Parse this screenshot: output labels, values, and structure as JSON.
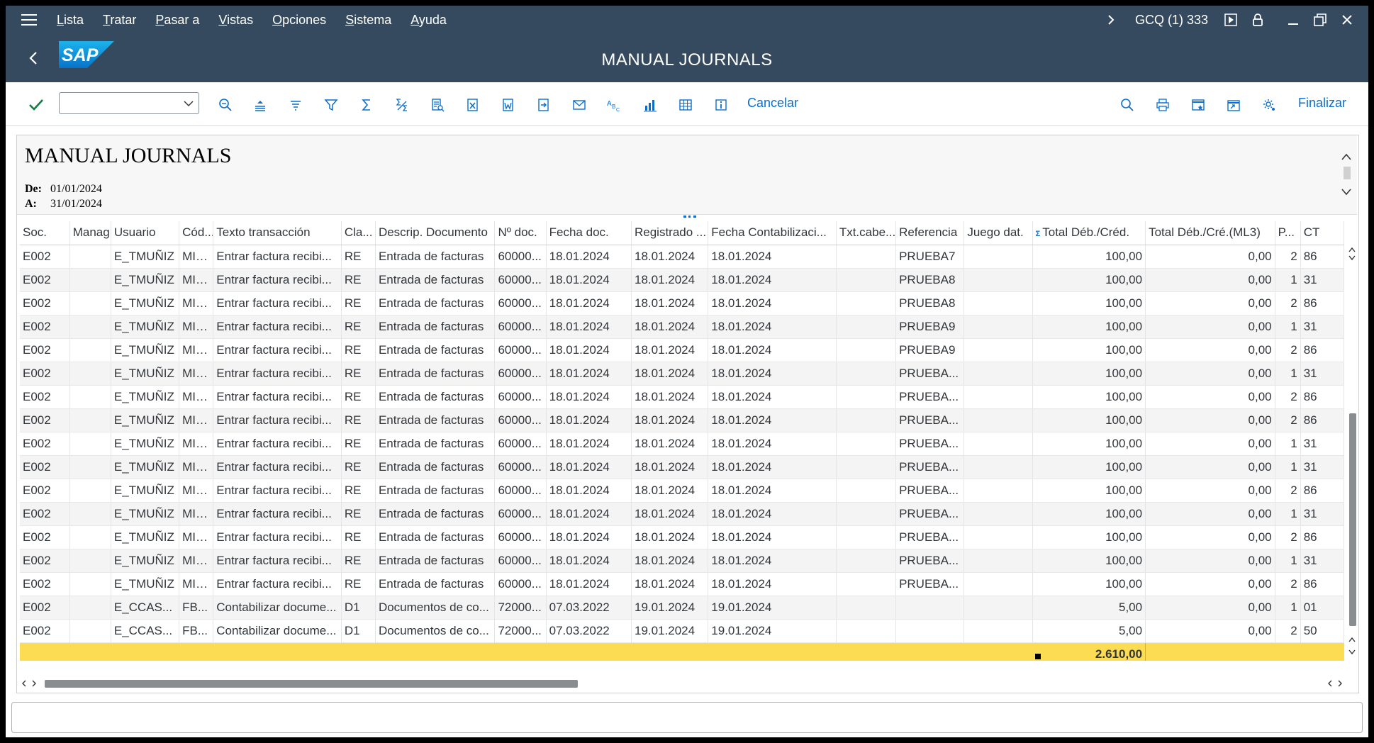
{
  "menu": [
    "Lista",
    "Tratar",
    "Pasar a",
    "Vistas",
    "Opciones",
    "Sistema",
    "Ayuda"
  ],
  "system_info": "GCQ (1) 333",
  "title": "MANUAL JOURNALS",
  "logo_text": "SAP",
  "toolbar": {
    "cancel_label": "Cancelar",
    "finish_label": "Finalizar",
    "layout_value": ""
  },
  "report": {
    "title": "MANUAL JOURNALS",
    "from_label": "De:",
    "from_date": "01/01/2024",
    "to_label": "A:",
    "to_date": "31/01/2024"
  },
  "columns": [
    "Soc.",
    "Manag...",
    "Usuario",
    "Cód...",
    "Texto transacción",
    "Cla...",
    "Descrip. Documento",
    "Nº doc.",
    "Fecha doc.",
    "Registrado ...",
    "Fecha Contabilizaci...",
    "Txt.cabe...",
    "Referencia",
    "Juego dat.",
    "Total Déb./Créd.",
    "Total Déb./Cré.(ML3)",
    "P...",
    "CT"
  ],
  "rows": [
    [
      "E002",
      "",
      "E_TMUÑIZ",
      "MIR...",
      "Entrar factura recibi...",
      "RE",
      "Entrada de facturas",
      "60000...",
      "18.01.2024",
      "18.01.2024",
      "18.01.2024",
      "",
      "PRUEBA7",
      "",
      "100,00",
      "0,00",
      "2",
      "86"
    ],
    [
      "E002",
      "",
      "E_TMUÑIZ",
      "MIR...",
      "Entrar factura recibi...",
      "RE",
      "Entrada de facturas",
      "60000...",
      "18.01.2024",
      "18.01.2024",
      "18.01.2024",
      "",
      "PRUEBA8",
      "",
      "100,00",
      "0,00",
      "1",
      "31"
    ],
    [
      "E002",
      "",
      "E_TMUÑIZ",
      "MIR...",
      "Entrar factura recibi...",
      "RE",
      "Entrada de facturas",
      "60000...",
      "18.01.2024",
      "18.01.2024",
      "18.01.2024",
      "",
      "PRUEBA8",
      "",
      "100,00",
      "0,00",
      "2",
      "86"
    ],
    [
      "E002",
      "",
      "E_TMUÑIZ",
      "MIR...",
      "Entrar factura recibi...",
      "RE",
      "Entrada de facturas",
      "60000...",
      "18.01.2024",
      "18.01.2024",
      "18.01.2024",
      "",
      "PRUEBA9",
      "",
      "100,00",
      "0,00",
      "1",
      "31"
    ],
    [
      "E002",
      "",
      "E_TMUÑIZ",
      "MIR...",
      "Entrar factura recibi...",
      "RE",
      "Entrada de facturas",
      "60000...",
      "18.01.2024",
      "18.01.2024",
      "18.01.2024",
      "",
      "PRUEBA9",
      "",
      "100,00",
      "0,00",
      "2",
      "86"
    ],
    [
      "E002",
      "",
      "E_TMUÑIZ",
      "MIR...",
      "Entrar factura recibi...",
      "RE",
      "Entrada de facturas",
      "60000...",
      "18.01.2024",
      "18.01.2024",
      "18.01.2024",
      "",
      "PRUEBA...",
      "",
      "100,00",
      "0,00",
      "1",
      "31"
    ],
    [
      "E002",
      "",
      "E_TMUÑIZ",
      "MIR...",
      "Entrar factura recibi...",
      "RE",
      "Entrada de facturas",
      "60000...",
      "18.01.2024",
      "18.01.2024",
      "18.01.2024",
      "",
      "PRUEBA...",
      "",
      "100,00",
      "0,00",
      "2",
      "86"
    ],
    [
      "E002",
      "",
      "E_TMUÑIZ",
      "MIR...",
      "Entrar factura recibi...",
      "RE",
      "Entrada de facturas",
      "60000...",
      "18.01.2024",
      "18.01.2024",
      "18.01.2024",
      "",
      "PRUEBA...",
      "",
      "100,00",
      "0,00",
      "2",
      "86"
    ],
    [
      "E002",
      "",
      "E_TMUÑIZ",
      "MIR...",
      "Entrar factura recibi...",
      "RE",
      "Entrada de facturas",
      "60000...",
      "18.01.2024",
      "18.01.2024",
      "18.01.2024",
      "",
      "PRUEBA...",
      "",
      "100,00",
      "0,00",
      "1",
      "31"
    ],
    [
      "E002",
      "",
      "E_TMUÑIZ",
      "MIR...",
      "Entrar factura recibi...",
      "RE",
      "Entrada de facturas",
      "60000...",
      "18.01.2024",
      "18.01.2024",
      "18.01.2024",
      "",
      "PRUEBA...",
      "",
      "100,00",
      "0,00",
      "1",
      "31"
    ],
    [
      "E002",
      "",
      "E_TMUÑIZ",
      "MIR...",
      "Entrar factura recibi...",
      "RE",
      "Entrada de facturas",
      "60000...",
      "18.01.2024",
      "18.01.2024",
      "18.01.2024",
      "",
      "PRUEBA...",
      "",
      "100,00",
      "0,00",
      "2",
      "86"
    ],
    [
      "E002",
      "",
      "E_TMUÑIZ",
      "MIR...",
      "Entrar factura recibi...",
      "RE",
      "Entrada de facturas",
      "60000...",
      "18.01.2024",
      "18.01.2024",
      "18.01.2024",
      "",
      "PRUEBA...",
      "",
      "100,00",
      "0,00",
      "1",
      "31"
    ],
    [
      "E002",
      "",
      "E_TMUÑIZ",
      "MIR...",
      "Entrar factura recibi...",
      "RE",
      "Entrada de facturas",
      "60000...",
      "18.01.2024",
      "18.01.2024",
      "18.01.2024",
      "",
      "PRUEBA...",
      "",
      "100,00",
      "0,00",
      "2",
      "86"
    ],
    [
      "E002",
      "",
      "E_TMUÑIZ",
      "MIR...",
      "Entrar factura recibi...",
      "RE",
      "Entrada de facturas",
      "60000...",
      "18.01.2024",
      "18.01.2024",
      "18.01.2024",
      "",
      "PRUEBA...",
      "",
      "100,00",
      "0,00",
      "1",
      "31"
    ],
    [
      "E002",
      "",
      "E_TMUÑIZ",
      "MIR...",
      "Entrar factura recibi...",
      "RE",
      "Entrada de facturas",
      "60000...",
      "18.01.2024",
      "18.01.2024",
      "18.01.2024",
      "",
      "PRUEBA...",
      "",
      "100,00",
      "0,00",
      "2",
      "86"
    ],
    [
      "E002",
      "",
      "E_CCAS...",
      "FB...",
      "Contabilizar docume...",
      "D1",
      "Documentos de co...",
      "72000...",
      "07.03.2022",
      "19.01.2024",
      "19.01.2024",
      "",
      "",
      "",
      "5,00",
      "0,00",
      "1",
      "01"
    ],
    [
      "E002",
      "",
      "E_CCAS...",
      "FB...",
      "Contabilizar docume...",
      "D1",
      "Documentos de co...",
      "72000...",
      "07.03.2022",
      "19.01.2024",
      "19.01.2024",
      "",
      "",
      "",
      "5,00",
      "0,00",
      "2",
      "50"
    ]
  ],
  "total": "2.610,00",
  "colors": {
    "shell": "#354a5f",
    "accent": "#0a6ed1",
    "total_row": "#fbdc52",
    "check": "#107e3e"
  }
}
